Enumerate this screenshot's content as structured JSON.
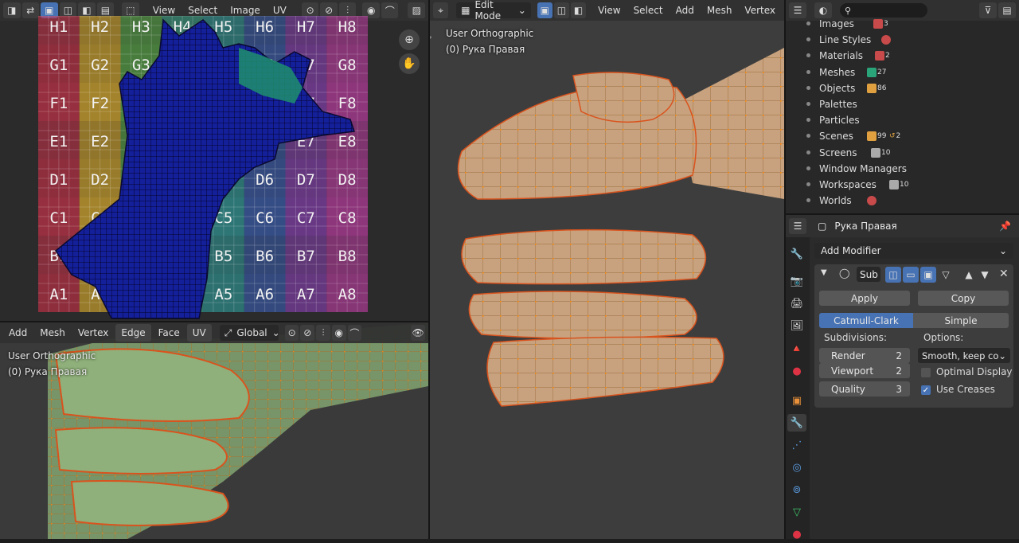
{
  "uv_editor": {
    "header": {
      "menus": [
        "View",
        "Select",
        "Image",
        "UV"
      ]
    },
    "grid_cols": [
      "1",
      "2",
      "3",
      "4",
      "5",
      "6",
      "7",
      "8"
    ],
    "grid_rows": [
      "H",
      "G",
      "F",
      "E",
      "D",
      "C",
      "B",
      "A"
    ],
    "grid_colors": [
      "#d0314a",
      "#e3b22b",
      "#5cb34a",
      "#3aa88a",
      "#2f9e9e",
      "#3a5fb5",
      "#8a3fb5",
      "#c33ca6"
    ]
  },
  "left_viewport": {
    "header": {
      "menus": [
        "Add",
        "Mesh",
        "Vertex",
        "Edge",
        "Face",
        "UV"
      ],
      "transform_orientation": "Global"
    },
    "overlay": {
      "view_name": "User Orthographic",
      "object_name": "(0) Рука Правая"
    }
  },
  "main_viewport": {
    "header": {
      "mode": "Edit Mode",
      "menus": [
        "View",
        "Select",
        "Add",
        "Mesh",
        "Vertex"
      ]
    },
    "overlay": {
      "view_name": "User Orthographic",
      "object_name": "(0) Рука Правая"
    }
  },
  "outliner": {
    "search_placeholder": "",
    "rows": [
      {
        "label": "Images",
        "badge": "3",
        "color": "#c84a4a"
      },
      {
        "label": "Line Styles",
        "badge": "",
        "color": "#c84a4a"
      },
      {
        "label": "Materials",
        "badge": "2",
        "color": "#c84a4a"
      },
      {
        "label": "Meshes",
        "badge": "27",
        "color": "#2aa57a"
      },
      {
        "label": "Objects",
        "badge": "86",
        "color": "#e0a040"
      },
      {
        "label": "Palettes",
        "badge": "",
        "color": "#888888"
      },
      {
        "label": "Particles",
        "badge": "",
        "color": "#888888"
      },
      {
        "label": "Scenes",
        "badge": "99",
        "badge2": "2",
        "color": "#e0a040"
      },
      {
        "label": "Screens",
        "badge": "10",
        "color": "#aaaaaa"
      },
      {
        "label": "Window Managers",
        "badge": "",
        "color": "#888888"
      },
      {
        "label": "Workspaces",
        "badge": "10",
        "color": "#aaaaaa"
      },
      {
        "label": "Worlds",
        "badge": "",
        "color": "#c84a4a"
      }
    ]
  },
  "properties": {
    "object_name": "Рука Правая",
    "add_modifier": "Add Modifier",
    "modifier": {
      "name": "Sub",
      "apply": "Apply",
      "copy": "Copy",
      "types": [
        "Catmull-Clark",
        "Simple"
      ],
      "active_type": "Catmull-Clark",
      "subdivisions_label": "Subdivisions:",
      "options_label": "Options:",
      "render_label": "Render",
      "render_value": "2",
      "viewport_label": "Viewport",
      "viewport_value": "2",
      "quality_label": "Quality",
      "quality_value": "3",
      "uv_smooth": "Smooth, keep co...",
      "optimal_display": "Optimal Display",
      "optimal_display_checked": false,
      "use_creases": "Use Creases",
      "use_creases_checked": true
    },
    "colors": {
      "accent": "#4772b3",
      "panel": "#3d3d3d"
    }
  }
}
